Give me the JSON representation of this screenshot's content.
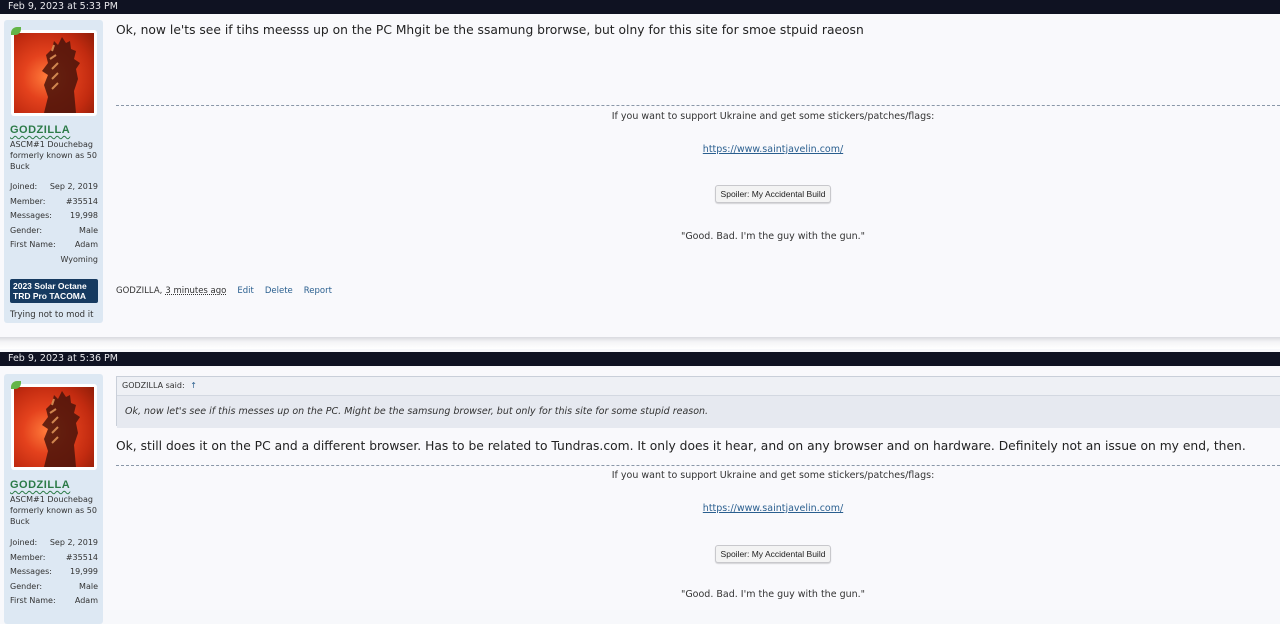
{
  "posts": [
    {
      "date": "Feb 9, 2023 at 5:33 PM",
      "author": {
        "username": "GODZILLA",
        "title": "ASCM#1 Douchebag formerly known as 50 Buck",
        "stats": [
          {
            "label": "Joined:",
            "value": "Sep 2, 2019"
          },
          {
            "label": "Member:",
            "value": "#35514"
          },
          {
            "label": "Messages:",
            "value": "19,998"
          },
          {
            "label": "Gender:",
            "value": "Male"
          },
          {
            "label": "First Name:",
            "value": "Adam"
          }
        ],
        "location": "Wyoming",
        "truck_badge": "2023 Solar Octane TRD Pro TACOMA",
        "note": "Trying not to mod it"
      },
      "message": "Ok, now le'ts see if tihs meesss up on the PC Mhgit be the ssamung brorwse, but olny for this site for smoe stpuid raeosn",
      "signature": {
        "ukraine_text": "If you want to support Ukraine and get some stickers/patches/flags:",
        "link": "https://www.saintjavelin.com/",
        "spoiler_label": "Spoiler: My Accidental Build",
        "quote": "\"Good. Bad. I'm the guy with the gun.\""
      },
      "footer": {
        "author": "GODZILLA,",
        "time": "3 minutes ago",
        "edit": "Edit",
        "delete": "Delete",
        "report": "Report"
      }
    },
    {
      "date": "Feb 9, 2023 at 5:36 PM",
      "author": {
        "username": "GODZILLA",
        "title": "ASCM#1 Douchebag formerly known as 50 Buck",
        "stats": [
          {
            "label": "Joined:",
            "value": "Sep 2, 2019"
          },
          {
            "label": "Member:",
            "value": "#35514"
          },
          {
            "label": "Messages:",
            "value": "19,999"
          },
          {
            "label": "Gender:",
            "value": "Male"
          },
          {
            "label": "First Name:",
            "value": "Adam"
          }
        ]
      },
      "quote": {
        "attribution": "GODZILLA said:",
        "arrow": "↑",
        "text": "Ok, now let's see if this messes up on the PC. Might be the samsung browser, but only for this site for some stupid reason."
      },
      "message": "Ok, still does it on the PC and a different browser. Has to be related to Tundras.com. It only does it hear, and on any browser and on hardware. Definitely not an issue on my end, then.",
      "signature": {
        "ukraine_text": "If you want to support Ukraine and get some stickers/patches/flags:",
        "link": "https://www.saintjavelin.com/",
        "spoiler_label": "Spoiler: My Accidental Build",
        "quote": "\"Good. Bad. I'm the guy with the gun.\""
      }
    }
  ]
}
